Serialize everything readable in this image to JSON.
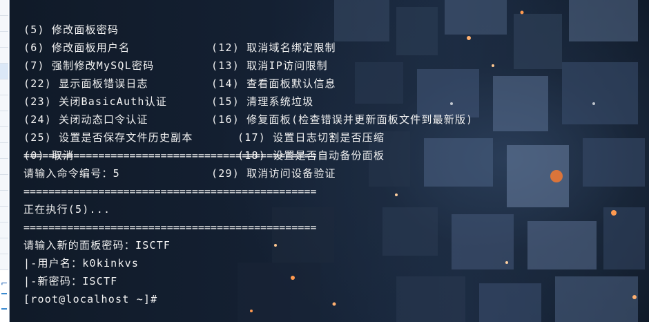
{
  "menu": [
    {
      "left": "(5) 修改面板密码",
      "right": "(12) 取消域名绑定限制"
    },
    {
      "left": "(6) 修改面板用户名",
      "right": "(13) 取消IP访问限制"
    },
    {
      "left": "(7) 强制修改MySQL密码",
      "right": "(14) 查看面板默认信息"
    },
    {
      "left": "(22) 显示面板错误日志",
      "right": "(15) 清理系统垃圾"
    },
    {
      "left": "(23) 关闭BasicAuth认证",
      "right": "(16) 修复面板(检查错误并更新面板文件到最新版)"
    },
    {
      "left": "(24) 关闭动态口令认证",
      "right": "(17) 设置日志切割是否压缩"
    },
    {
      "left": "(25) 设置是否保存文件历史副本",
      "right": "(18) 设置是否自动备份面板"
    },
    {
      "left": "(0) 取消",
      "right": "(29) 取消访问设备验证"
    }
  ],
  "separator": "===============================================",
  "prompt_command": "请输入命令编号：5",
  "executing": "正在执行(5)...",
  "prompt_password": "请输入新的面板密码：ISCTF",
  "username_line": "|-用户名：k0kinkvs",
  "password_line": "|-新密码：ISCTF",
  "shell_prompt": "[root@localhost ~]#",
  "colors": {
    "text": "#f3f3f3",
    "background": "#0c1420",
    "accent_bokeh": "#ff7a2a"
  }
}
